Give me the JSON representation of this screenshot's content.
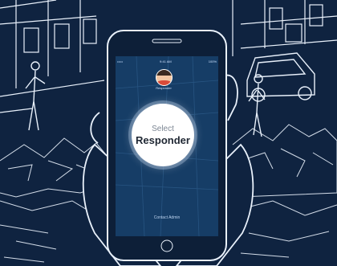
{
  "phone": {
    "status_carrier": "•••••",
    "status_time": "9:41 AM",
    "status_battery": "100%",
    "avatar_caption": "Responder",
    "select_line1": "Select",
    "select_line2": "Responder",
    "bottom_link": "Contact Admin"
  },
  "colors": {
    "background": "#0f2340",
    "line_art": "#e9f1fb",
    "screen": "#163d66",
    "button": "#ffffff"
  }
}
